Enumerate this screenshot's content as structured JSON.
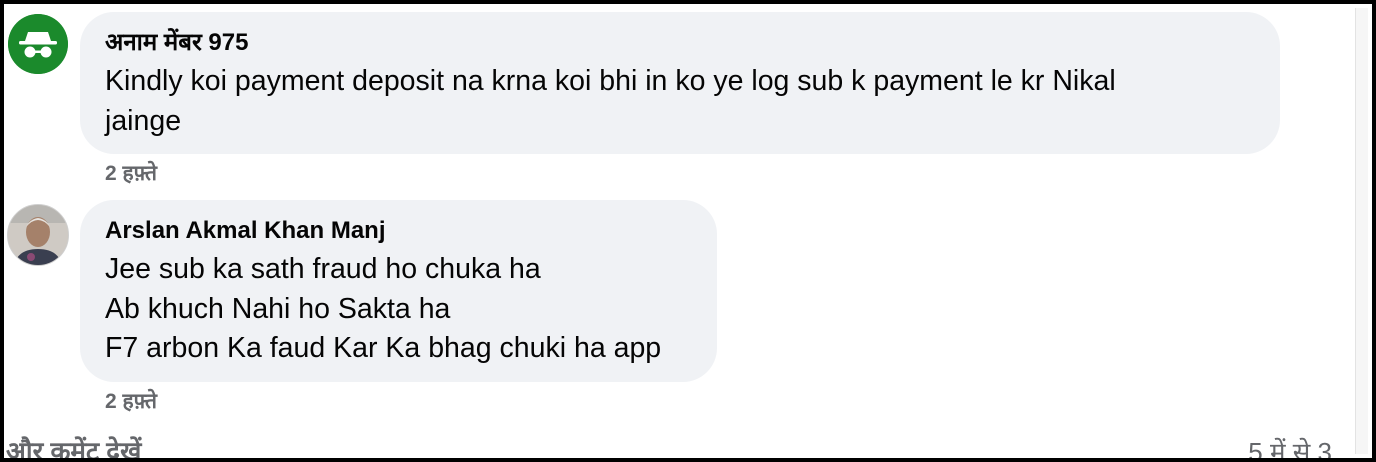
{
  "comments": [
    {
      "author": "अनाम मेंबर 975",
      "avatar_icon": "anonymous-incognito-icon",
      "avatar_color": "#1b8a2c",
      "lines": [
        "Kindly koi payment deposit na krna koi bhi in ko ye log sub k payment le kr Nikal",
        "jainge"
      ],
      "time": "2 हफ़्ते"
    },
    {
      "author": "Arslan Akmal Khan Manj",
      "avatar_icon": "profile-photo",
      "lines": [
        "Jee sub ka sath fraud ho chuka ha",
        "Ab khuch Nahi ho Sakta ha",
        "F7 arbon Ka faud Kar Ka bhag chuki ha app"
      ],
      "time": "2 हफ़्ते"
    }
  ],
  "footer": {
    "more_comments": "और कमेंट देखें",
    "count": "5 में से 3"
  }
}
